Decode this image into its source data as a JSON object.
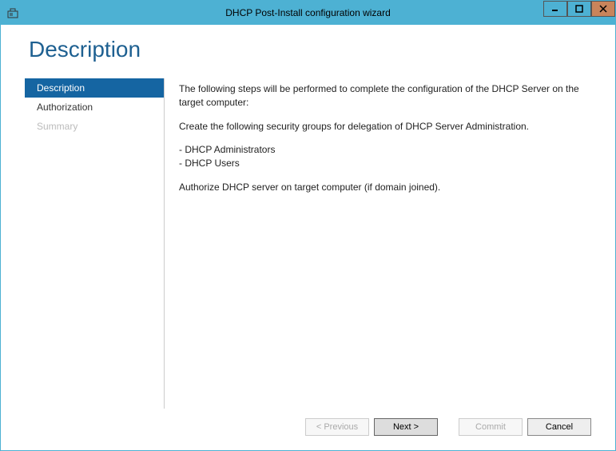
{
  "titlebar": {
    "title": "DHCP Post-Install configuration wizard"
  },
  "page": {
    "title": "Description"
  },
  "sidebar": {
    "items": [
      {
        "label": "Description",
        "selected": true,
        "disabled": false
      },
      {
        "label": "Authorization",
        "selected": false,
        "disabled": false
      },
      {
        "label": "Summary",
        "selected": false,
        "disabled": true
      }
    ]
  },
  "content": {
    "intro": "The following steps will be performed to complete the configuration of the DHCP Server on the target computer:",
    "groups_intro": "Create the following security groups for delegation of DHCP Server Administration.",
    "group1": "- DHCP Administrators",
    "group2": "- DHCP Users",
    "authorize": "Authorize DHCP server on target computer (if domain joined)."
  },
  "footer": {
    "previous": "< Previous",
    "next": "Next >",
    "commit": "Commit",
    "cancel": "Cancel"
  }
}
